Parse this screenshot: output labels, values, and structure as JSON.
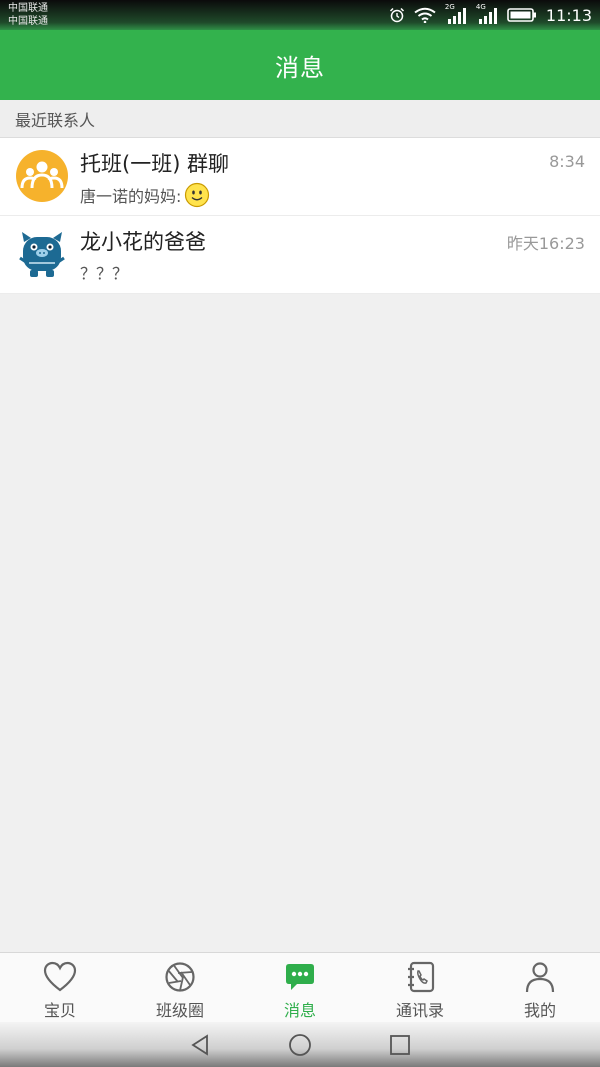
{
  "status_bar": {
    "carrier1": "中国联通",
    "carrier2": "中国联通",
    "signal1_label": "2G",
    "signal2_label": "4G",
    "time": "11:13",
    "icons": [
      "alarm-icon",
      "wifi-icon",
      "signal-icon",
      "signal-icon",
      "battery-icon"
    ]
  },
  "header": {
    "title": "消息"
  },
  "section": {
    "label": "最近联系人"
  },
  "conversations": [
    {
      "name": "托班(一班) 群聊",
      "time": "8:34",
      "preview": "唐一诺的妈妈:",
      "avatar": "group-avatar-icon",
      "emoji": "smiley-emoji-icon"
    },
    {
      "name": "龙小花的爸爸",
      "time": "昨天16:23",
      "preview": "？？？",
      "avatar": "cartoon-creature-avatar"
    }
  ],
  "tabs": [
    {
      "label": "宝贝",
      "icon": "heart-icon",
      "active": false
    },
    {
      "label": "班级圈",
      "icon": "aperture-icon",
      "active": false
    },
    {
      "label": "消息",
      "icon": "chat-bubble-icon",
      "active": true
    },
    {
      "label": "通讯录",
      "icon": "contacts-book-icon",
      "active": false
    },
    {
      "label": "我的",
      "icon": "person-icon",
      "active": false
    }
  ],
  "nav": {
    "icons": [
      "back-icon",
      "home-icon",
      "recents-icon"
    ]
  },
  "colors": {
    "accent": "#33b24d",
    "group_avatar": "#f6b22c",
    "pig_avatar": "#1d6a93"
  }
}
